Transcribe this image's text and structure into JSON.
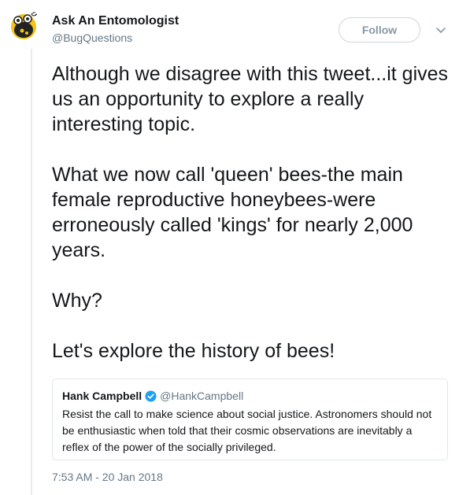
{
  "tweet": {
    "author": {
      "name": "Ask An Entomologist",
      "handle": "@BugQuestions",
      "avatar_icon": "cartoon-beetle-avatar-icon"
    },
    "follow_label": "Follow",
    "paragraphs": [
      "Although we disagree with this tweet...it gives us an opportunity to explore a really interesting topic.",
      "What we now call 'queen' bees-the main female reproductive honeybees-were erroneously called 'kings' for nearly 2,000 years.",
      "Why?",
      "Let's explore the history of bees!"
    ],
    "timestamp": "7:53 AM - 20 Jan 2018"
  },
  "quoted_tweet": {
    "name": "Hank Campbell",
    "verified": true,
    "handle": "@HankCampbell",
    "text": "Resist the call to make science about social justice. Astronomers should not be enthusiastic when told that their cosmic observations are inevitably a reflex of the power of the socially privileged."
  },
  "colors": {
    "text_primary": "#14171a",
    "text_secondary": "#657786",
    "border": "#e1e8ed",
    "verified_blue": "#1da1f2"
  }
}
